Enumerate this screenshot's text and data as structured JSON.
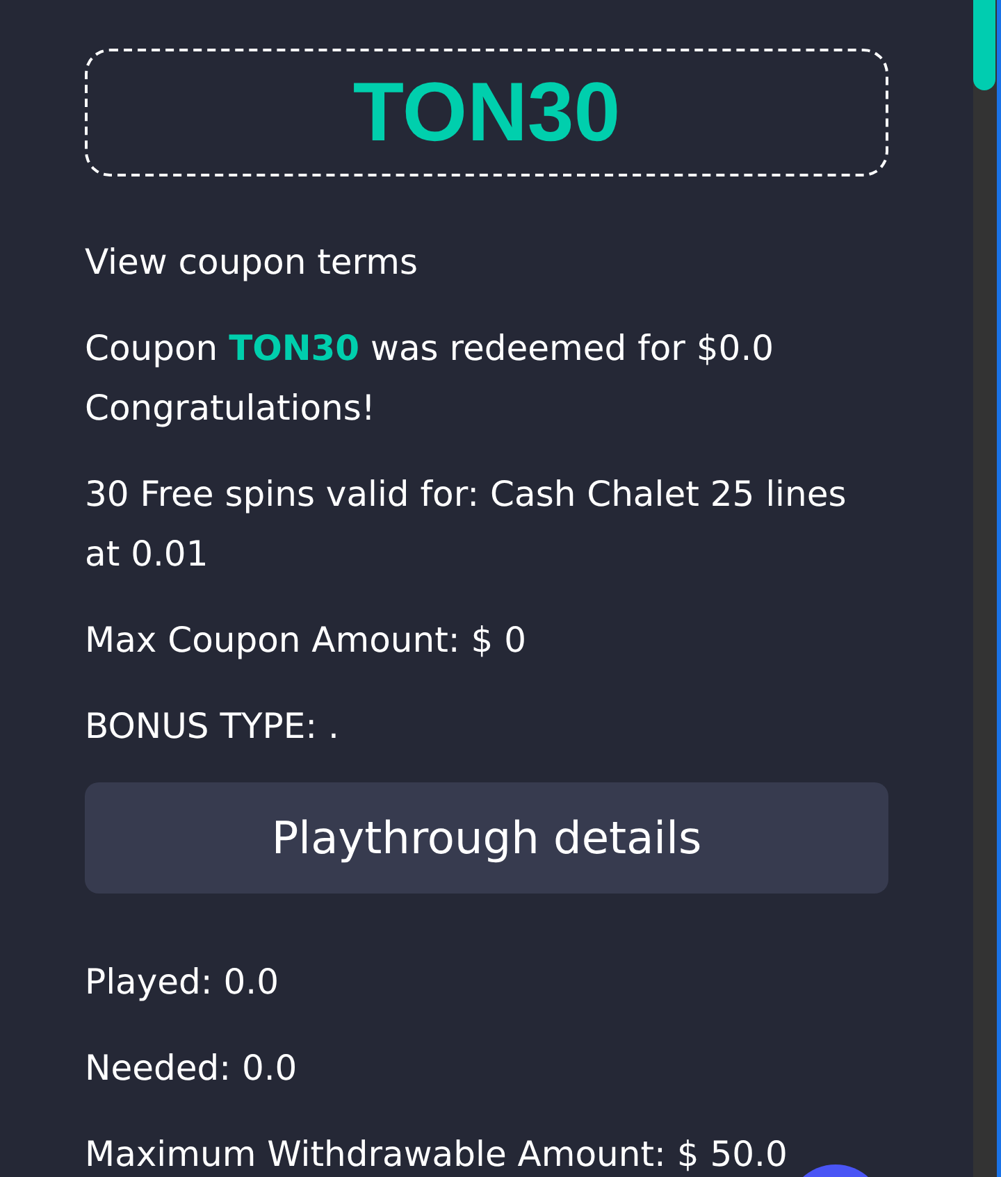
{
  "coupon": {
    "code": "TON30"
  },
  "terms_link": {
    "label": "View coupon terms"
  },
  "messages": [
    "Coupon **TON30** was redeemed for $0.0 Congratulations!",
    "30 Free spins valid for: Cash Chalet 25 lines at 0.01",
    "Max Coupon Amount: $ 0",
    "BONUS TYPE: ."
  ],
  "playthrough_button": {
    "label": "Playthrough details"
  },
  "playthrough_details": [
    "Played: 0.0",
    "Needed: 0.0",
    "Maximum Withdrawable Amount: $ 50.0"
  ]
}
